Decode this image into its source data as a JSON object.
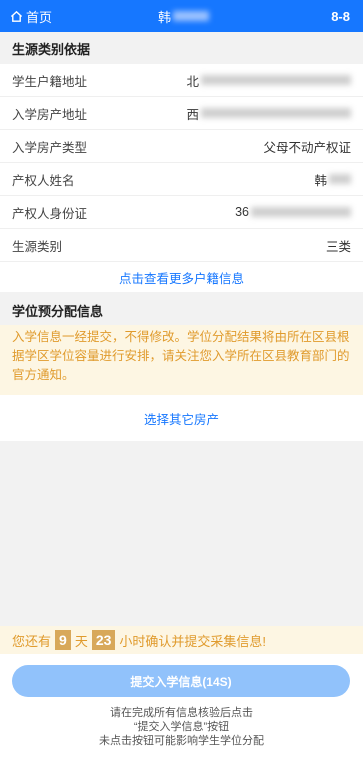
{
  "header": {
    "home_label": "首页",
    "title_prefix": "韩",
    "badge": "8-8",
    "accent": "#1677ff"
  },
  "basis": {
    "title": "生源类别依据",
    "rows": [
      {
        "label": "学生户籍地址",
        "value": "北"
      },
      {
        "label": "入学房产地址",
        "value": "西"
      },
      {
        "label": "入学房产类型",
        "value": "父母不动产权证"
      },
      {
        "label": "产权人姓名",
        "value": "韩"
      },
      {
        "label": "产权人身份证",
        "value": "36"
      },
      {
        "label": "生源类别",
        "value": "三类"
      }
    ],
    "more_link": "点击查看更多户籍信息"
  },
  "allocation": {
    "title": "学位预分配信息",
    "notice": "入学信息一经提交，不得修改。学位分配结果将由所在区县根据学区学位容量进行安排，请关注您入学所在区县教育部门的官方通知。",
    "choose_link": "选择其它房产"
  },
  "countdown": {
    "prefix": "您还有",
    "days": "9",
    "day_unit": "天",
    "hours": "23",
    "suffix": "小时确认并提交采集信息!"
  },
  "footer": {
    "submit_label": "提交入学信息(14S)",
    "hint1": "请在完成所有信息核验后点击",
    "hint2": "“提交入学信息”按钮",
    "hint3": "未点击按钮可能影响学生学位分配"
  }
}
